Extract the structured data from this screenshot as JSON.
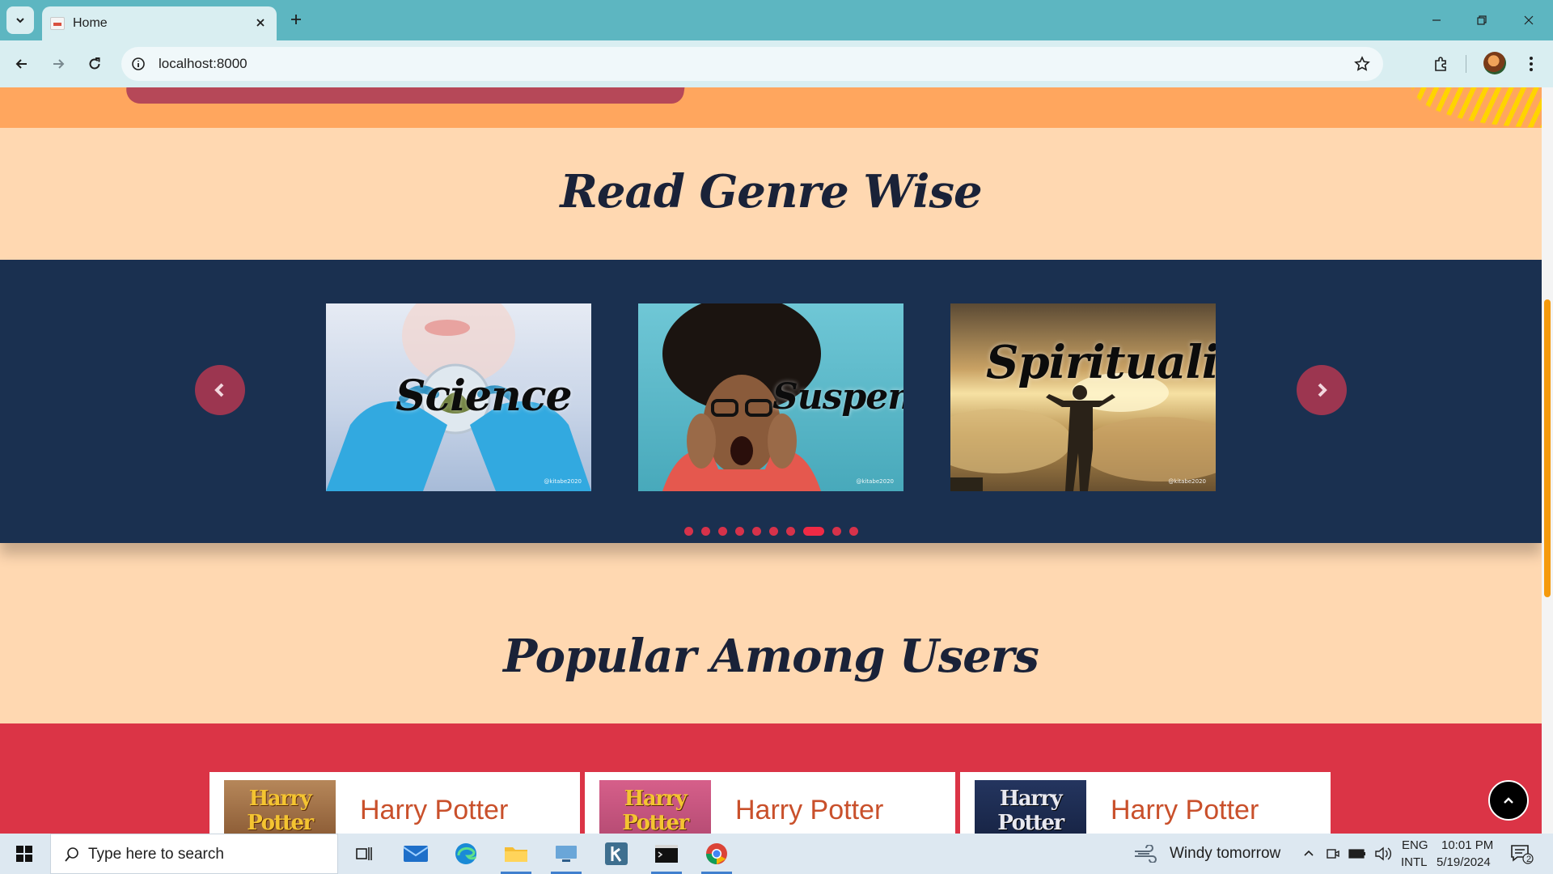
{
  "browser": {
    "tab_title": "Home",
    "url": "localhost:8000",
    "new_tab_label": "+"
  },
  "page": {
    "genre_section_title": "Read Genre Wise",
    "popular_section_title": "Popular Among Users",
    "genres": [
      {
        "label": "Science",
        "watermark": "@kitabe2020"
      },
      {
        "label": "Suspense",
        "watermark": "@kitabe2020"
      },
      {
        "label": "Spirituality",
        "watermark": "@kitabe2020"
      }
    ],
    "carousel": {
      "dot_count": 10,
      "active_index": 7
    },
    "books": [
      {
        "title": "Harry Potter",
        "cover_text": "Harry Potter"
      },
      {
        "title": "Harry Potter",
        "cover_text": "Harry Potter"
      },
      {
        "title": "Harry Potter",
        "cover_text": "Harry Potter"
      }
    ]
  },
  "taskbar": {
    "search_placeholder": "Type here to search",
    "weather": "Windy tomorrow",
    "lang_top": "ENG",
    "lang_bottom": "INTL",
    "time": "10:01 PM",
    "date": "5/19/2024",
    "notification_count": "2"
  },
  "colors": {
    "page_bg": "#ffd8b1",
    "genre_band": "#1a3050",
    "popular_band": "#db3446",
    "accent_arrow": "#9c3650",
    "title_text": "#1a2238"
  }
}
